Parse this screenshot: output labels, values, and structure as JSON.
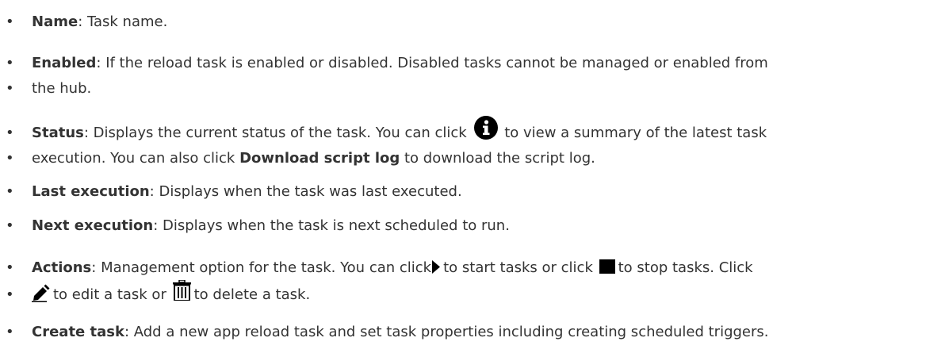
{
  "items": [
    {
      "term": "Name",
      "text": ": Task name."
    },
    {
      "term": "Enabled",
      "text": ": If the reload task is enabled or disabled. Disabled tasks cannot be managed or enabled from",
      "text2": "the hub."
    },
    {
      "term": "Status",
      "text_a": ": Displays the current status of the task. You can click",
      "text_b": "to view a summary of the latest task",
      "text_c": "execution. You can also click",
      "bold_link": "Download script log",
      "text_d": "to download the script log."
    },
    {
      "term": "Last execution",
      "text": ": Displays when the task was last executed."
    },
    {
      "term": "Next execution",
      "text": ": Displays when the task is next scheduled to run."
    },
    {
      "term": "Actions",
      "text_a": ": Management option for the task. You can click",
      "text_b": "to start tasks or click",
      "text_c": "to stop tasks. Click",
      "text_d": "to edit a task or",
      "text_e": "to delete a task."
    },
    {
      "term": "Create task",
      "text": ": Add a new app reload task and set task properties including creating scheduled triggers."
    }
  ],
  "icons": {
    "info": "info-circle-icon",
    "play": "play-icon",
    "stop": "stop-icon",
    "edit": "pencil-icon",
    "delete": "trash-icon"
  }
}
